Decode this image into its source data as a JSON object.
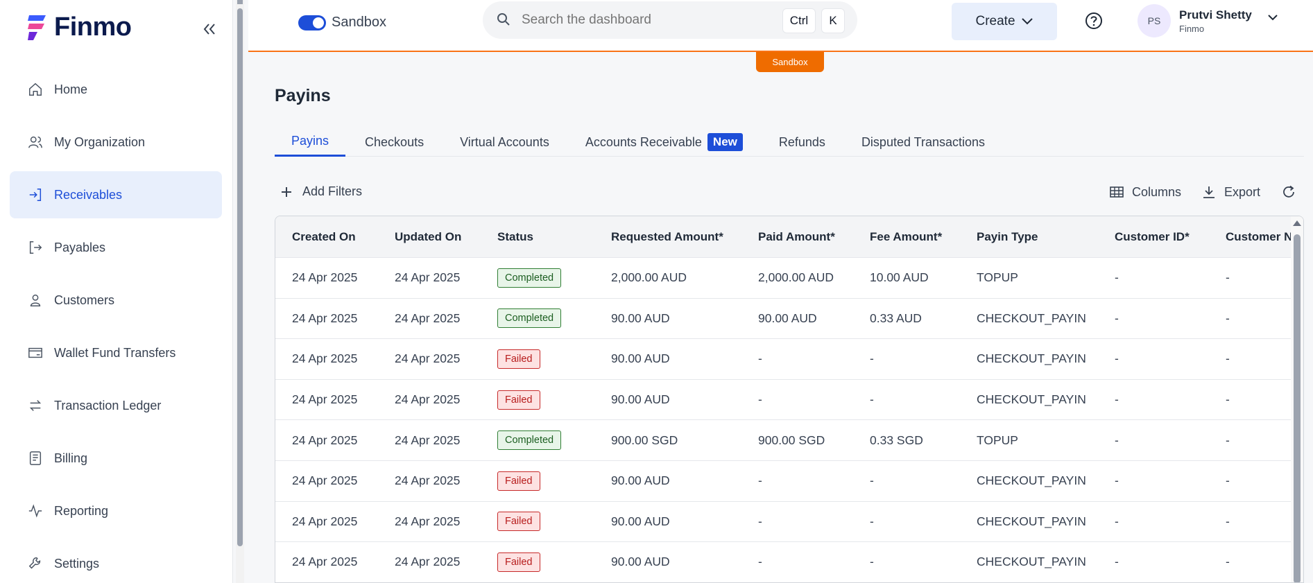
{
  "brand": {
    "name": "Finmo"
  },
  "sidebar": {
    "items": [
      {
        "label": "Home",
        "icon": "home-icon"
      },
      {
        "label": "My Organization",
        "icon": "users-icon"
      },
      {
        "label": "Receivables",
        "icon": "arrow-in-icon",
        "active": true
      },
      {
        "label": "Payables",
        "icon": "arrow-out-icon"
      },
      {
        "label": "Customers",
        "icon": "user-icon"
      },
      {
        "label": "Wallet Fund Transfers",
        "icon": "wallet-transfer-icon"
      },
      {
        "label": "Transaction Ledger",
        "icon": "swap-icon"
      },
      {
        "label": "Billing",
        "icon": "billing-icon"
      },
      {
        "label": "Reporting",
        "icon": "activity-icon"
      },
      {
        "label": "Settings",
        "icon": "wrench-icon"
      }
    ]
  },
  "header": {
    "sandbox_label": "Sandbox",
    "search_placeholder": "Search the dashboard",
    "shortcut_ctrl": "Ctrl",
    "shortcut_key": "K",
    "create_label": "Create",
    "user": {
      "initials": "PS",
      "name": "Prutvi Shetty",
      "org": "Finmo"
    },
    "env_tag": "Sandbox"
  },
  "page": {
    "title": "Payins",
    "tabs": [
      {
        "label": "Payins",
        "active": true
      },
      {
        "label": "Checkouts"
      },
      {
        "label": "Virtual Accounts"
      },
      {
        "label": "Accounts Receivable",
        "badge": "New"
      },
      {
        "label": "Refunds"
      },
      {
        "label": "Disputed Transactions"
      }
    ],
    "add_filters": "Add Filters",
    "columns_label": "Columns",
    "export_label": "Export"
  },
  "table": {
    "headers": [
      "Created On",
      "Updated On",
      "Status",
      "Requested Amount*",
      "Paid Amount*",
      "Fee Amount*",
      "Payin Type",
      "Customer ID*",
      "Customer N"
    ],
    "rows": [
      [
        "24 Apr 2025",
        "24 Apr 2025",
        "Completed",
        "2,000.00 AUD",
        "2,000.00 AUD",
        "10.00 AUD",
        "TOPUP",
        "-",
        "-"
      ],
      [
        "24 Apr 2025",
        "24 Apr 2025",
        "Completed",
        "90.00 AUD",
        "90.00 AUD",
        "0.33 AUD",
        "CHECKOUT_PAYIN",
        "-",
        "-"
      ],
      [
        "24 Apr 2025",
        "24 Apr 2025",
        "Failed",
        "90.00 AUD",
        "-",
        "-",
        "CHECKOUT_PAYIN",
        "-",
        "-"
      ],
      [
        "24 Apr 2025",
        "24 Apr 2025",
        "Failed",
        "90.00 AUD",
        "-",
        "-",
        "CHECKOUT_PAYIN",
        "-",
        "-"
      ],
      [
        "24 Apr 2025",
        "24 Apr 2025",
        "Completed",
        "900.00 SGD",
        "900.00 SGD",
        "0.33 SGD",
        "TOPUP",
        "-",
        "-"
      ],
      [
        "24 Apr 2025",
        "24 Apr 2025",
        "Failed",
        "90.00 AUD",
        "-",
        "-",
        "CHECKOUT_PAYIN",
        "-",
        "-"
      ],
      [
        "24 Apr 2025",
        "24 Apr 2025",
        "Failed",
        "90.00 AUD",
        "-",
        "-",
        "CHECKOUT_PAYIN",
        "-",
        "-"
      ],
      [
        "24 Apr 2025",
        "24 Apr 2025",
        "Failed",
        "90.00 AUD",
        "-",
        "-",
        "CHECKOUT_PAYIN",
        "-",
        "-"
      ]
    ]
  },
  "colors": {
    "accent": "#1d4ed8",
    "sandbox": "#ef6c00",
    "success": "#2e7d32",
    "danger": "#c62828"
  }
}
